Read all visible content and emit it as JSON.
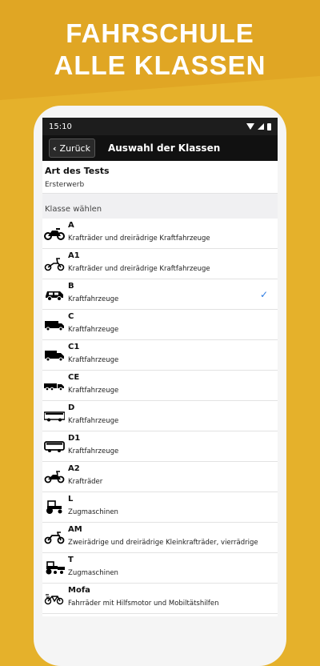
{
  "banner": {
    "line1": "FAHRSCHULE",
    "line2": "ALLE KLASSEN"
  },
  "status_bar": {
    "time": "15:10"
  },
  "navbar": {
    "back_label": "Zurück",
    "title": "Auswahl der Klassen"
  },
  "test_type": {
    "label": "Art des Tests",
    "value": "Ersterwerb"
  },
  "class_section": {
    "header": "Klasse wählen"
  },
  "classes": [
    {
      "code": "A",
      "desc": "Krafträder und dreirädrige Kraftfahrzeuge",
      "icon": "motorcycle-icon",
      "selected": false
    },
    {
      "code": "A1",
      "desc": "Krafträder und dreirädrige Kraftfahrzeuge",
      "icon": "scooter-icon",
      "selected": false
    },
    {
      "code": "B",
      "desc": "Kraftfahrzeuge",
      "icon": "car-icon",
      "selected": true
    },
    {
      "code": "C",
      "desc": "Kraftfahrzeuge",
      "icon": "truck-icon",
      "selected": false
    },
    {
      "code": "C1",
      "desc": "Kraftfahrzeuge",
      "icon": "small-truck-icon",
      "selected": false
    },
    {
      "code": "CE",
      "desc": "Kraftfahrzeuge",
      "icon": "truck-trailer-icon",
      "selected": false
    },
    {
      "code": "D",
      "desc": "Kraftfahrzeuge",
      "icon": "bus-icon",
      "selected": false
    },
    {
      "code": "D1",
      "desc": "Kraftfahrzeuge",
      "icon": "minibus-icon",
      "selected": false
    },
    {
      "code": "A2",
      "desc": "Krafträder",
      "icon": "moped-icon",
      "selected": false
    },
    {
      "code": "L",
      "desc": "Zugmaschinen",
      "icon": "tractor-icon",
      "selected": false
    },
    {
      "code": "AM",
      "desc": "Zweirädrige und dreirädrige Kleinkrafträder, vierrädrige",
      "icon": "small-motorbike-icon",
      "selected": false
    },
    {
      "code": "T",
      "desc": "Zugmaschinen",
      "icon": "tractor-trailer-icon",
      "selected": false
    },
    {
      "code": "Mofa",
      "desc": "Fahrräder mit Hilfsmotor und Mobiltätshilfen",
      "icon": "mofa-icon",
      "selected": false
    }
  ],
  "colors": {
    "background": "#e5b12b",
    "navbar": "#111111",
    "check": "#2a7ae2"
  }
}
